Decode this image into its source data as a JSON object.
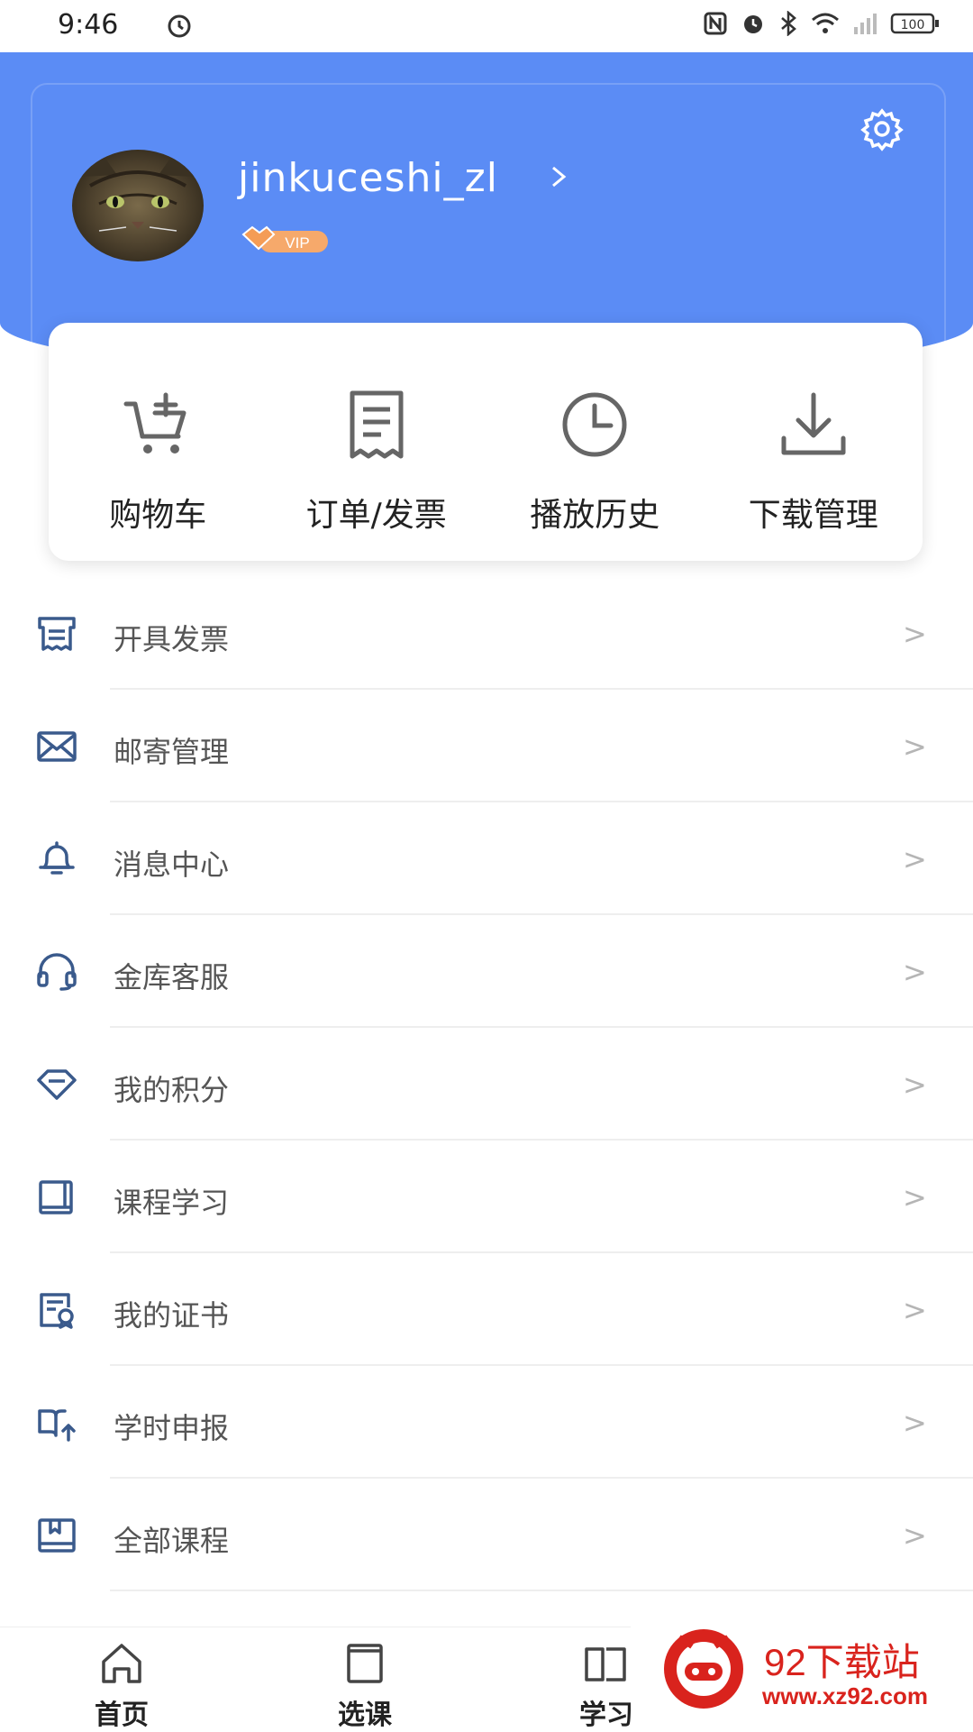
{
  "status_bar": {
    "time": "9:46",
    "battery": "100"
  },
  "profile": {
    "username": "jinkuceshi_zl",
    "vip_label": "VIP"
  },
  "quick_actions": [
    {
      "label": "购物车",
      "icon": "cart-icon"
    },
    {
      "label": "订单/发票",
      "icon": "receipt-icon"
    },
    {
      "label": "播放历史",
      "icon": "clock-icon"
    },
    {
      "label": "下载管理",
      "icon": "download-icon"
    }
  ],
  "menu": [
    {
      "label": "开具发票",
      "icon": "invoice-icon"
    },
    {
      "label": "邮寄管理",
      "icon": "mail-icon"
    },
    {
      "label": "消息中心",
      "icon": "bell-icon"
    },
    {
      "label": "金库客服",
      "icon": "headset-icon"
    },
    {
      "label": "我的积分",
      "icon": "diamond-icon"
    },
    {
      "label": "课程学习",
      "icon": "book-icon"
    },
    {
      "label": "我的证书",
      "icon": "certificate-icon"
    },
    {
      "label": "学时申报",
      "icon": "open-book-upload-icon"
    },
    {
      "label": "全部课程",
      "icon": "bookmark-book-icon"
    }
  ],
  "chevron": ">",
  "tabbar": [
    {
      "label": "首页",
      "icon": "home-icon"
    },
    {
      "label": "选课",
      "icon": "course-icon"
    },
    {
      "label": "学习",
      "icon": "study-book-icon"
    }
  ],
  "watermark": {
    "title": "92下载站",
    "url": "www.xz92.com"
  },
  "colors": {
    "header_blue": "#5b8cf5",
    "icon_blue": "#3a5a8c",
    "watermark_red": "#d9231d"
  }
}
